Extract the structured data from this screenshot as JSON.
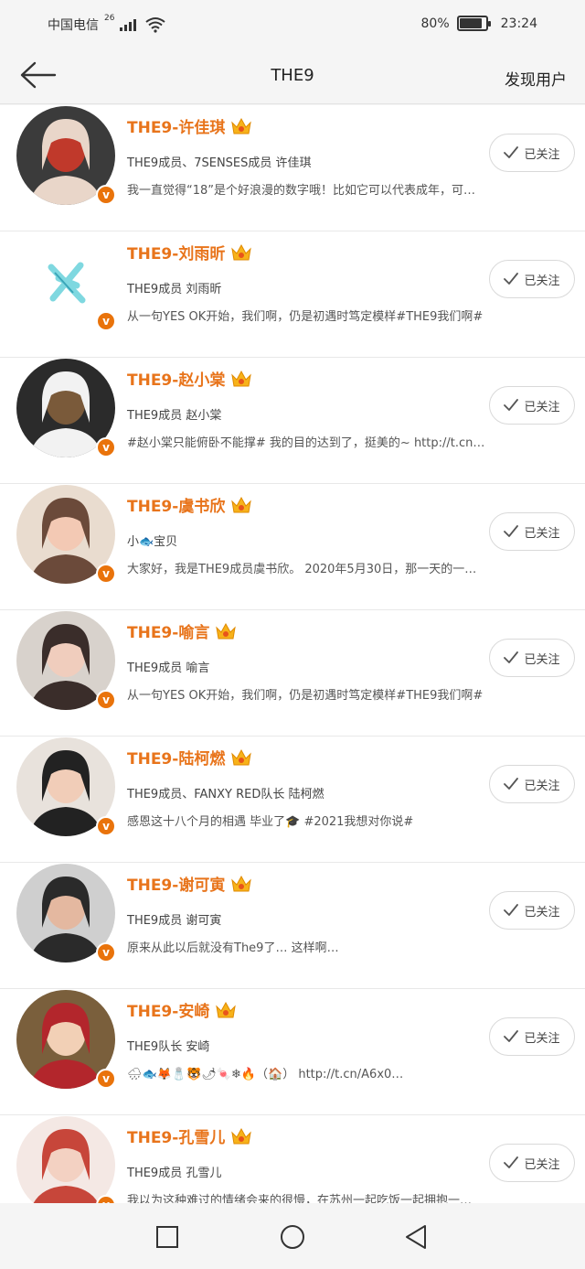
{
  "status_bar": {
    "carrier": "中国电信",
    "network": "26",
    "battery": "80%",
    "time": "23:24"
  },
  "header": {
    "title": "THE9",
    "action_label": "发现用户"
  },
  "follow_label": "已关注",
  "users": [
    {
      "name": "THE9-许佳琪",
      "desc": "THE9成员、7SENSES成员 许佳琪",
      "post": "我一直觉得“18”是个好浪漫的数字哦！比如它可以代表成年，可…"
    },
    {
      "name": "THE9-刘雨昕",
      "desc": "THE9成员 刘雨昕",
      "post": "从一句YES OK开始，我们啊，仍是初遇时笃定模样#THE9我们啊#"
    },
    {
      "name": "THE9-赵小棠",
      "desc": "THE9成员 赵小棠",
      "post": "#赵小棠只能俯卧不能撑# 我的目的达到了，挺美的~ http://t.cn…"
    },
    {
      "name": "THE9-虞书欣",
      "desc": "小🐟宝贝",
      "post": "大家好，我是THE9成员虞书欣。 2020年5月30日，那一天的一…"
    },
    {
      "name": "THE9-喻言",
      "desc": "THE9成员 喻言",
      "post": "从一句YES OK开始，我们啊，仍是初遇时笃定模样#THE9我们啊#"
    },
    {
      "name": "THE9-陆柯燃",
      "desc": "THE9成员、FANXY RED队长 陆柯燃",
      "post": "感恩这十八个月的相遇 毕业了🎓 #2021我想对你说#"
    },
    {
      "name": "THE9-谢可寅",
      "desc": "THE9成员 谢可寅",
      "post": "原来从此以后就没有The9了… 这样啊…"
    },
    {
      "name": "THE9-安崎",
      "desc": "THE9队长 安崎",
      "post": "🌧🐟🦊🧂🐯🌶🍬❄🔥（🏠） http://t.cn/A6x0…"
    },
    {
      "name": "THE9-孔雪儿",
      "desc": "THE9成员 孔雪儿",
      "post": "我以为这种难过的情绪会来的很慢，在苏州一起吃饭一起拥抱一…"
    }
  ]
}
